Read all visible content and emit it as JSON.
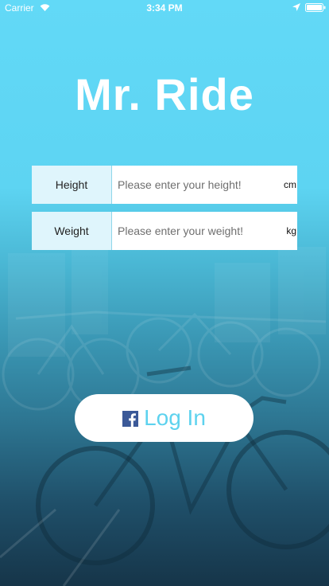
{
  "status_bar": {
    "carrier": "Carrier",
    "time": "3:34 PM"
  },
  "app": {
    "title": "Mr. Ride"
  },
  "form": {
    "height": {
      "label": "Height",
      "placeholder": "Please enter your height!",
      "unit": "cm"
    },
    "weight": {
      "label": "Weight",
      "placeholder": "Please enter your weight!",
      "unit": "kg"
    }
  },
  "login": {
    "label": "Log In",
    "icon": "facebook-icon"
  },
  "colors": {
    "gradient_top": "#62d9f7",
    "gradient_bottom": "#163549",
    "accent": "#5dd2ee",
    "label_bg": "#dff5fc",
    "facebook": "#3b5998"
  }
}
